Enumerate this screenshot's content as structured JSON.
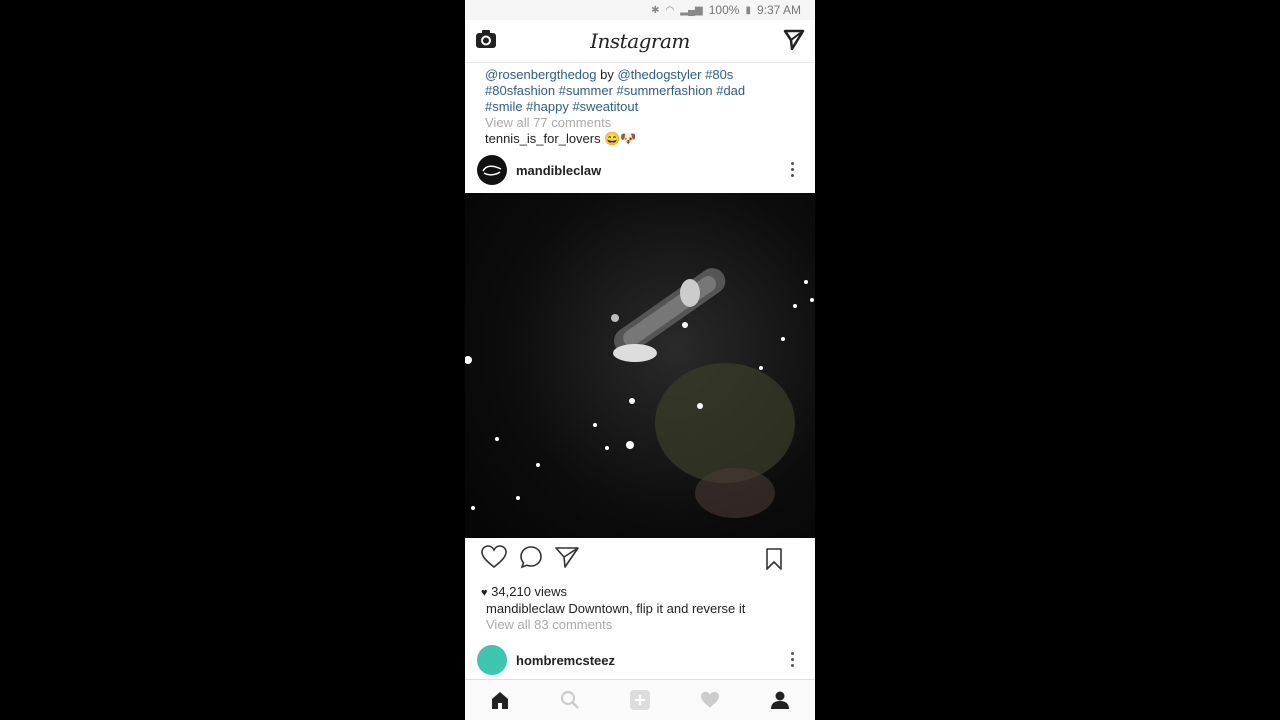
{
  "status": {
    "battery": "100%",
    "time": "9:37 AM",
    "icons": [
      "bluetooth-icon",
      "wifi-icon",
      "signal-icon",
      "battery-icon"
    ]
  },
  "header": {
    "logo": "Instagram",
    "left_icon": "camera-icon",
    "right_icon": "direct-message-icon"
  },
  "prev_post": {
    "caption_line1_user1": "@rosenbergthedog",
    "caption_line1_by": " by ",
    "caption_line1_user2": "@thedogstyler",
    "caption_line1_tag": " #80s",
    "caption_line2": "#80sfashion #summer #summerfashion #dad",
    "caption_line3": "#smile #happy #sweatitout",
    "view_comments": "View all 77 comments",
    "comment_user": "tennis_is_for_lovers",
    "comment_text": " 😄🐶"
  },
  "post": {
    "username": "mandibleclaw",
    "views": "34,210 views",
    "caption_user": "mandibleclaw",
    "caption_text": " Downtown, flip it and reverse it",
    "view_comments": "View all 83 comments",
    "media_description": "night skateboard trick video"
  },
  "next_post": {
    "username": "hombremcsteez"
  },
  "nav": [
    "home-icon",
    "search-icon",
    "add-post-icon",
    "activity-heart-icon",
    "profile-icon"
  ],
  "colors": {
    "link": "#2d5e8f",
    "muted": "#aaaaaa",
    "teal_avatar": "#3cc5b0"
  }
}
